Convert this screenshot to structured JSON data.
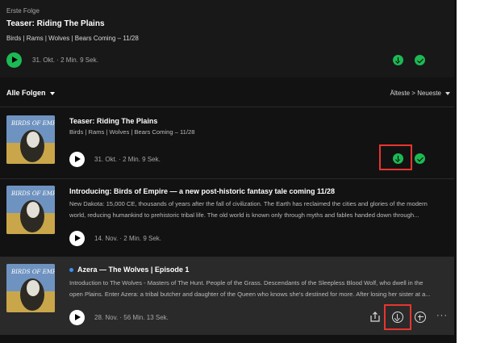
{
  "first_episode": {
    "label": "Erste Folge",
    "title": "Teaser: Riding The Plains",
    "description": "Birds | Rams | Wolves | Bears Coming – 11/28",
    "meta": "31. Okt. · 2 Min. 9 Sek."
  },
  "filter": {
    "left_label": "Alle Folgen",
    "sort_label": "Älteste > Neueste"
  },
  "cover_text": "BIRDS OF EMPIRE",
  "episodes": [
    {
      "title": "Teaser: Riding The Plains",
      "desc_lines": [
        "Birds | Rams | Wolves | Bears Coming – 11/28"
      ],
      "meta": "31. Okt. · 2 Min. 9 Sek.",
      "downloaded": true
    },
    {
      "title": "Introducing: Birds of Empire — a new post-historic fantasy tale coming 11/28",
      "desc_lines": [
        "New Dakota: 15,000 CE, thousands of years after the fall of civilization. The Earth has reclaimed the cities and glories of the modern",
        "world, reducing humankind to prehistoric tribal life. The old world is known only through myths and fables handed down through..."
      ],
      "meta": "14. Nov. · 2 Min. 9 Sek.",
      "downloaded": false
    },
    {
      "title": "Azera — The Wolves | Episode 1",
      "desc_lines": [
        "Introduction to The Wolves - Masters of The Hunt. People of the Grass. Descendants of the Sleepless Blood Wolf, who dwell in the",
        "open Plains. Enter Azera: a tribal butcher and daughter of the Queen who knows she's destined for more. After losing her sister at a..."
      ],
      "meta": "28. Nov. · 56 Min. 13 Sek.",
      "downloaded": false,
      "new": true
    }
  ],
  "colors": {
    "accent": "#1db954",
    "highlight_box": "#e8352e",
    "new_dot": "#3d91f4"
  }
}
